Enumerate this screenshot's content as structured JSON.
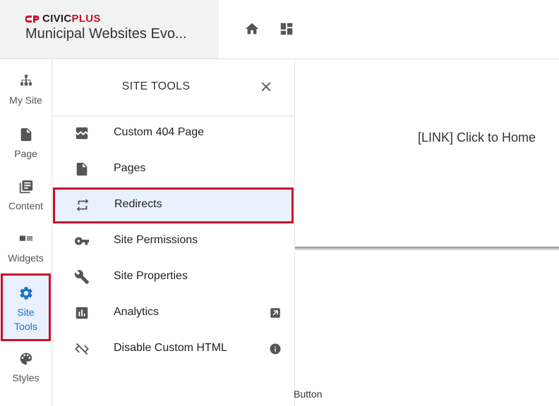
{
  "header": {
    "logo_part1": "CIVIC",
    "logo_part2": "PLUS",
    "site_name": "Municipal Websites Evo...",
    "icons": [
      "home-icon",
      "dashboard-icon"
    ]
  },
  "rail": {
    "items": [
      {
        "label": "My Site",
        "icon": "sitemap-icon"
      },
      {
        "label": "Page",
        "icon": "page-icon"
      },
      {
        "label": "Content",
        "icon": "content-icon"
      },
      {
        "label": "Widgets",
        "icon": "widgets-icon"
      },
      {
        "label_line1": "Site",
        "label_line2": "Tools",
        "icon": "gear-icon",
        "active": true
      },
      {
        "label": "Styles",
        "icon": "palette-icon"
      }
    ]
  },
  "panel": {
    "title": "SITE TOOLS",
    "items": [
      {
        "label": "Custom 404 Page",
        "icon": "broken-image-icon"
      },
      {
        "label": "Pages",
        "icon": "page-icon"
      },
      {
        "label": "Redirects",
        "icon": "redirect-icon",
        "highlighted": true
      },
      {
        "label": "Site Permissions",
        "icon": "key-icon"
      },
      {
        "label": "Site Properties",
        "icon": "wrench-icon"
      },
      {
        "label": "Analytics",
        "icon": "analytics-icon",
        "trailing_icon": "open-external-icon"
      },
      {
        "label": "Disable Custom HTML",
        "icon": "code-off-icon",
        "trailing_icon": "info-icon"
      }
    ]
  },
  "content": {
    "link_text": "[LINK] Click to Home",
    "button_text": "Button"
  },
  "colors": {
    "accent_red": "#c8102e",
    "active_blue": "#1a73c8",
    "highlight_bg": "#e8f1fd"
  }
}
